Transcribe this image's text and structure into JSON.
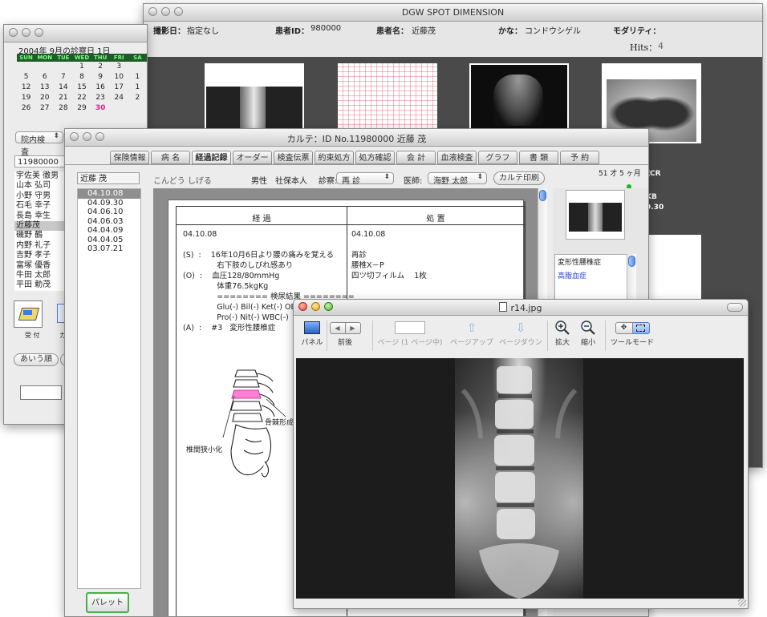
{
  "spot": {
    "title": "DGW SPOT DIMENSION",
    "satsuei_label": "撮影日：",
    "satsuei_value": "指定なし",
    "id_label": "患者ID：",
    "id_value": "980000",
    "name_label": "患者名：",
    "name_value": "近藤茂",
    "kana_label": "かな：",
    "kana_value": "コンドウシゲル",
    "modality_label": "モダリティ：",
    "hits_label": "Hits：",
    "hits_value": "4",
    "side_line1": "茂CR",
    "side_line2": "KB",
    "side_line3": "9.30"
  },
  "calendar": {
    "title": "2004年  9月の診察日    1日",
    "days": [
      "SUN",
      "MON",
      "TUE",
      "WED",
      "THU",
      "FRI",
      "SA"
    ],
    "weeks": [
      [
        "",
        "",
        "",
        "1",
        "2",
        "3",
        ""
      ],
      [
        "5",
        "6",
        "7",
        "8",
        "9",
        "10",
        "1"
      ],
      [
        "12",
        "13",
        "14",
        "15",
        "16",
        "17",
        "1"
      ],
      [
        "19",
        "20",
        "21",
        "22",
        "23",
        "24",
        "2"
      ],
      [
        "26",
        "27",
        "28",
        "29",
        "30",
        "",
        ""
      ]
    ],
    "search_select": "院内検査",
    "id_input": "11980000",
    "patients": [
      "宇佐美 徹男",
      "山本 弘司",
      "小野 守男",
      "石毛 幸子",
      "長島 幸生",
      "近藤茂",
      "磯野 鶴",
      "内野 礼子",
      "吉野 孝子",
      "富塚 優香",
      "牛田 太郎",
      "平田 勅茂"
    ],
    "selected_patient": 5,
    "icon1_label": "受 付",
    "icon2_label": "カ",
    "sort_button": "あいう順"
  },
  "karte": {
    "title": "カルテ：ID No.11980000   近藤  茂",
    "tabs": [
      "保険情報",
      "病 名",
      "経過記録",
      "オーダー",
      "検査伝票",
      "約束処方",
      "処方確認",
      "会 計",
      "血液検査",
      "グラフ",
      "書 類",
      "予 約"
    ],
    "active_tab": 2,
    "patient_name": "近藤  茂",
    "kana": "こんどう  しげる",
    "gender": "男性",
    "insurance": "社保本人",
    "shinsatsu_label": "診察:",
    "shinsatsu_value": "再 診",
    "doctor_label": "医師:",
    "doctor_value": "海野 太郎",
    "print_button": "カルテ印刷",
    "age": "51 才    5 ヶ月",
    "dates": [
      "04.10.08",
      "04.09.30",
      "04.06.10",
      "04.06.03",
      "04.04.09",
      "04.04.05",
      "03.07.21"
    ],
    "selected_date": 0,
    "col1_header": "経             過",
    "col2_header": "処             置",
    "left_lines": [
      "04.10.08",
      "",
      "(S)  :    16年10月6日より腰の痛みを覚える",
      "              右下肢のしびれ感あり",
      "(O)  :    血圧128/80mmHg",
      "              体重76.5kgKg",
      "              ======== 検尿結果 ========",
      "              Glu(-) Bil(-) Ket(-) OB(-)",
      "              Pro(-) Nit(-) WBC(-)",
      "(A)  :    #3   変形性腰椎症"
    ],
    "right_lines": [
      "04.10.08",
      "",
      "再診",
      "腰椎X－P",
      "四ツ切フィルム    1枚"
    ],
    "label_bone": "骨棘形成",
    "label_disc": "椎間狭小化",
    "disease1": "変形性腰椎症",
    "disease2": "高脂血症",
    "palette_button": "パレット"
  },
  "viewer": {
    "title": "r14.jpg",
    "panel_label": "パネル",
    "back_label": "前後",
    "page_label": "ページ (1 ページ中)",
    "page_up_label": "ページアップ",
    "page_down_label": "ページダウン",
    "zoom_in_label": "拡大",
    "zoom_out_label": "縮小",
    "tool_mode_label": "ツールモード"
  },
  "colors": {
    "accent_blue": "#2a3fd9",
    "today_pink": "#e0208a",
    "cal_header_bg": "#1f5c2a",
    "cal_header_text": "#7dff7d",
    "gallery_bg": "#4a4a4a"
  }
}
